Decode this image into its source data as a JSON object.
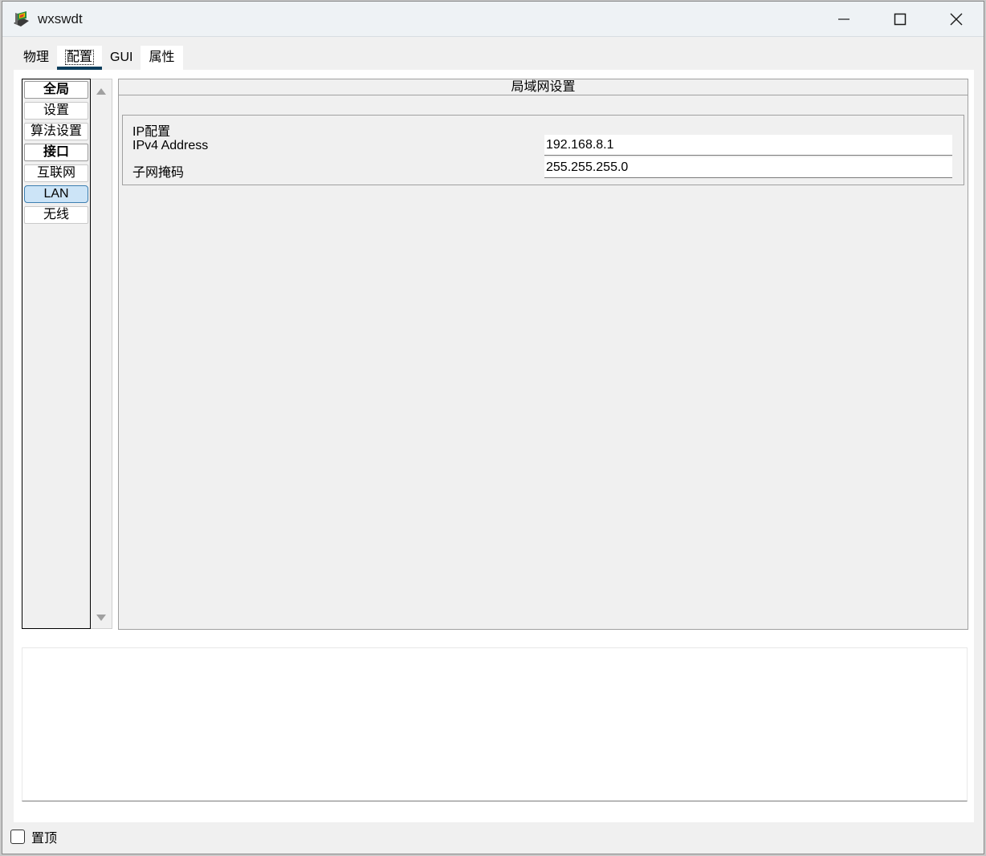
{
  "window": {
    "title": "wxswdt",
    "icon": "packet-tracer-icon",
    "controls": [
      "minimize-icon",
      "maximize-icon",
      "close-icon"
    ]
  },
  "tabs": [
    {
      "label": "物理",
      "active": false
    },
    {
      "label": "配置",
      "active": true
    },
    {
      "label": "GUI",
      "active": false
    },
    {
      "label": "属性",
      "active": false
    }
  ],
  "nav": {
    "items": [
      {
        "label": "全局",
        "header": true,
        "selected": false
      },
      {
        "label": "设置",
        "header": false,
        "selected": false
      },
      {
        "label": "算法设置",
        "header": false,
        "selected": false
      },
      {
        "label": "接口",
        "header": true,
        "selected": false
      },
      {
        "label": "互联网",
        "header": false,
        "selected": false
      },
      {
        "label": "LAN",
        "header": false,
        "selected": true
      },
      {
        "label": "无线",
        "header": false,
        "selected": false
      }
    ]
  },
  "panel": {
    "title": "局域网设置",
    "ip_group": {
      "title": "IP配置",
      "ipv4_label": "IPv4 Address",
      "ipv4_value": "192.168.8.1",
      "mask_label": "子网掩码",
      "mask_value": "255.255.255.0"
    }
  },
  "log": {
    "text": ""
  },
  "footer": {
    "always_on_top_label": "置顶",
    "always_on_top_checked": false
  },
  "colors": {
    "selected_bg": "#cce4f7",
    "selected_border": "#3c7fb1",
    "active_tab_underline": "#0b3d5c"
  }
}
